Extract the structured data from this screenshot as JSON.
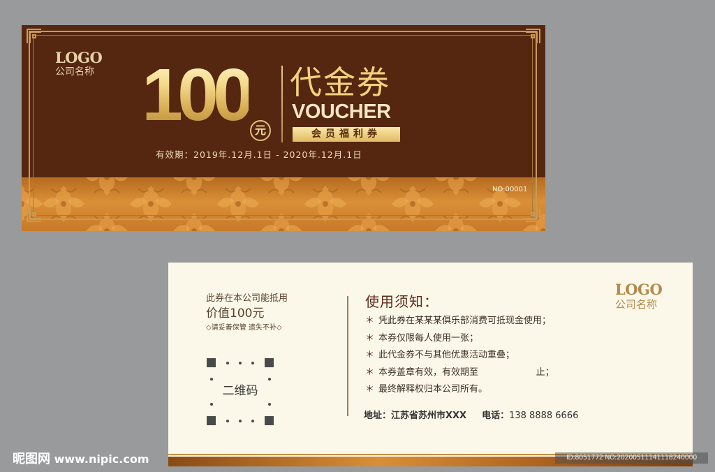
{
  "front": {
    "logo_word": "LOGO",
    "logo_company": "公司名称",
    "amount": "100",
    "currency_unit": "元",
    "title_cn": "代金券",
    "title_en": "VOUCHER",
    "member_badge": "会员福利券",
    "validity": "有效期：2019年.12月.1日 - 2020年.12月.1日",
    "serial_no": "NO:00001",
    "colors": {
      "background": "#552710",
      "gold": "#e2c27a",
      "band": "#d98f36"
    }
  },
  "back": {
    "usage_line1": "此券在本公司能抵用",
    "usage_line2": "价值100元",
    "keep_note": "◇请妥善保管 遗失不补◇",
    "qr_label": "二维码",
    "notice_title": "使用须知：",
    "bullet": "＊",
    "notices": [
      "凭此券在某某某俱乐部消费可抵现金使用；",
      "本券仅限每人使用一张；",
      "此代金券不与其他优惠活动重叠；",
      "本券盖章有效，有效期至                    止；",
      "最终解释权归本公司所有。"
    ],
    "address_label": "地址：",
    "address_value": "江苏省苏州市XXX",
    "phone_label": "电话：",
    "phone_value": "138 8888 6666",
    "logo_word": "LOGO",
    "logo_company": "公司名称"
  },
  "watermark": {
    "site_brand": "昵图网",
    "site_url": "www.nipic.com",
    "image_id": "ID:8051772 NO:20200511141118240000"
  }
}
